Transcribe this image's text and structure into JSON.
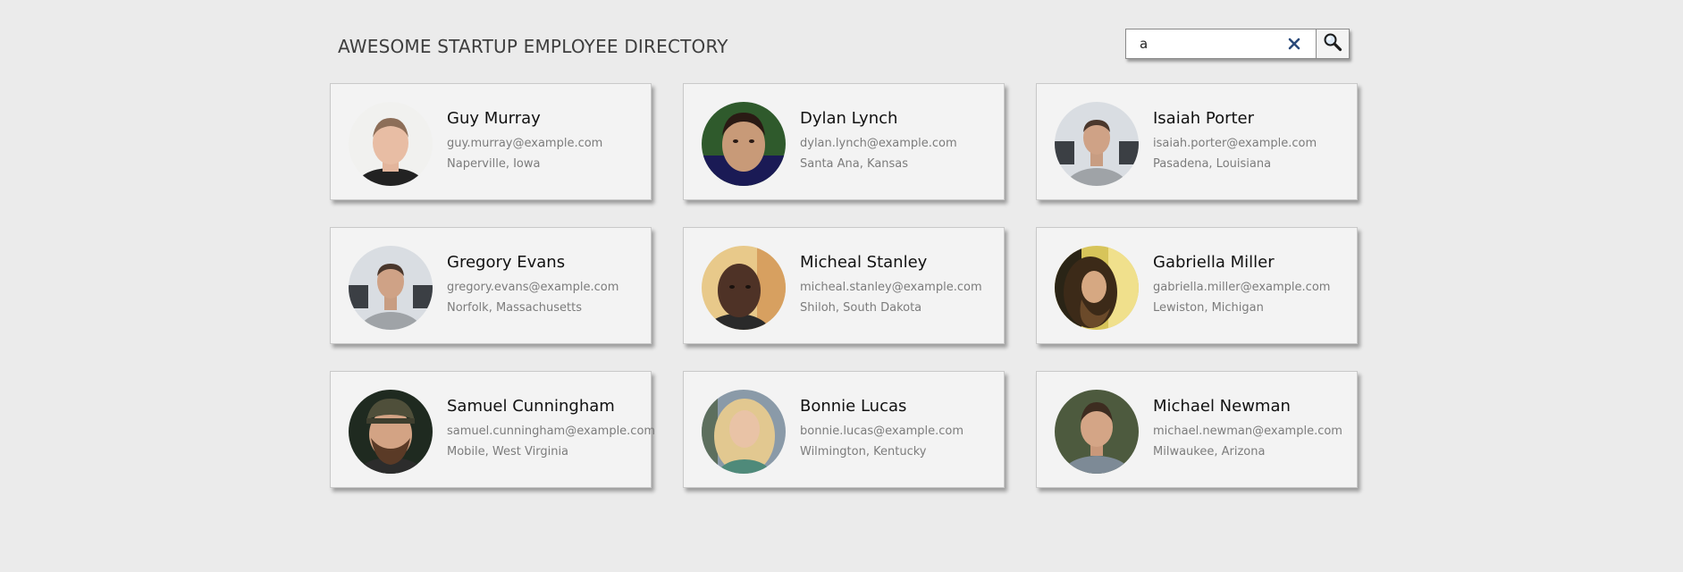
{
  "header": {
    "title": "AWESOME STARTUP EMPLOYEE DIRECTORY"
  },
  "search": {
    "value": "a",
    "clear_icon": "close-icon",
    "search_icon": "search-icon"
  },
  "employees": [
    {
      "name": "Guy Murray",
      "email": "guy.murray@example.com",
      "location": "Naperville, Iowa"
    },
    {
      "name": "Dylan Lynch",
      "email": "dylan.lynch@example.com",
      "location": "Santa Ana, Kansas"
    },
    {
      "name": "Isaiah Porter",
      "email": "isaiah.porter@example.com",
      "location": "Pasadena, Louisiana"
    },
    {
      "name": "Gregory Evans",
      "email": "gregory.evans@example.com",
      "location": "Norfolk, Massachusetts"
    },
    {
      "name": "Micheal Stanley",
      "email": "micheal.stanley@example.com",
      "location": "Shiloh, South Dakota"
    },
    {
      "name": "Gabriella Miller",
      "email": "gabriella.miller@example.com",
      "location": "Lewiston, Michigan"
    },
    {
      "name": "Samuel Cunningham",
      "email": "samuel.cunningham@example.com",
      "location": "Mobile, West Virginia"
    },
    {
      "name": "Bonnie Lucas",
      "email": "bonnie.lucas@example.com",
      "location": "Wilmington, Kentucky"
    },
    {
      "name": "Michael Newman",
      "email": "michael.newman@example.com",
      "location": "Milwaukee, Arizona"
    }
  ],
  "colors": {
    "background": "#ebebeb",
    "card": "#f3f3f3",
    "clear_icon": "#2b4a7a"
  }
}
